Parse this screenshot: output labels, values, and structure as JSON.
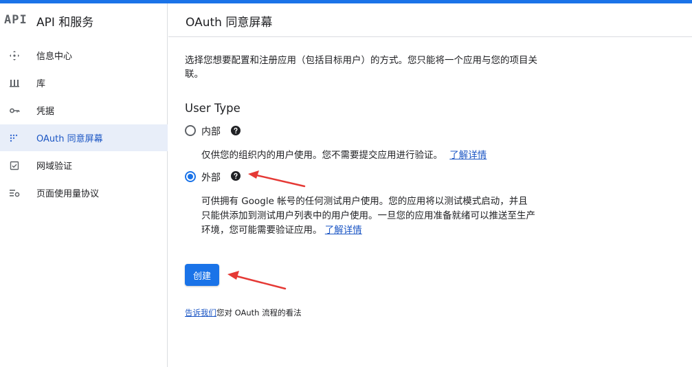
{
  "brand": {
    "logo": "API",
    "title": "API 和服务"
  },
  "sidebar": {
    "items": [
      {
        "label": "信息中心",
        "icon": "dashboard-icon",
        "active": false
      },
      {
        "label": "库",
        "icon": "library-icon",
        "active": false
      },
      {
        "label": "凭据",
        "icon": "key-icon",
        "active": false
      },
      {
        "label": "OAuth 同意屏幕",
        "icon": "oauth-consent-icon",
        "active": true
      },
      {
        "label": "网域验证",
        "icon": "domain-check-icon",
        "active": false
      },
      {
        "label": "页面使用量协议",
        "icon": "settings-list-icon",
        "active": false
      }
    ]
  },
  "header": {
    "title": "OAuth 同意屏幕"
  },
  "main": {
    "description": "选择您想要配置和注册应用（包括目标用户）的方式。您只能将一个应用与您的项目关联。",
    "user_type_heading": "User Type",
    "options": [
      {
        "label": "内部",
        "selected": false,
        "description": "仅供您的组织内的用户使用。您不需要提交应用进行验证。",
        "link": "了解详情"
      },
      {
        "label": "外部",
        "selected": true,
        "description": "可供拥有 Google 帐号的任何测试用户使用。您的应用将以测试模式启动，并且只能供添加到测试用户列表中的用户使用。一旦您的应用准备就绪可以推送至生产环境，您可能需要验证应用。",
        "link": "了解详情"
      }
    ],
    "create_button": "创建",
    "feedback_link": "告诉我们",
    "feedback_text": "您对 OAuth 流程的看法"
  },
  "colors": {
    "accent": "#1a73e8",
    "active_bg": "#e8eef9",
    "annotation_arrow": "#e53935"
  }
}
